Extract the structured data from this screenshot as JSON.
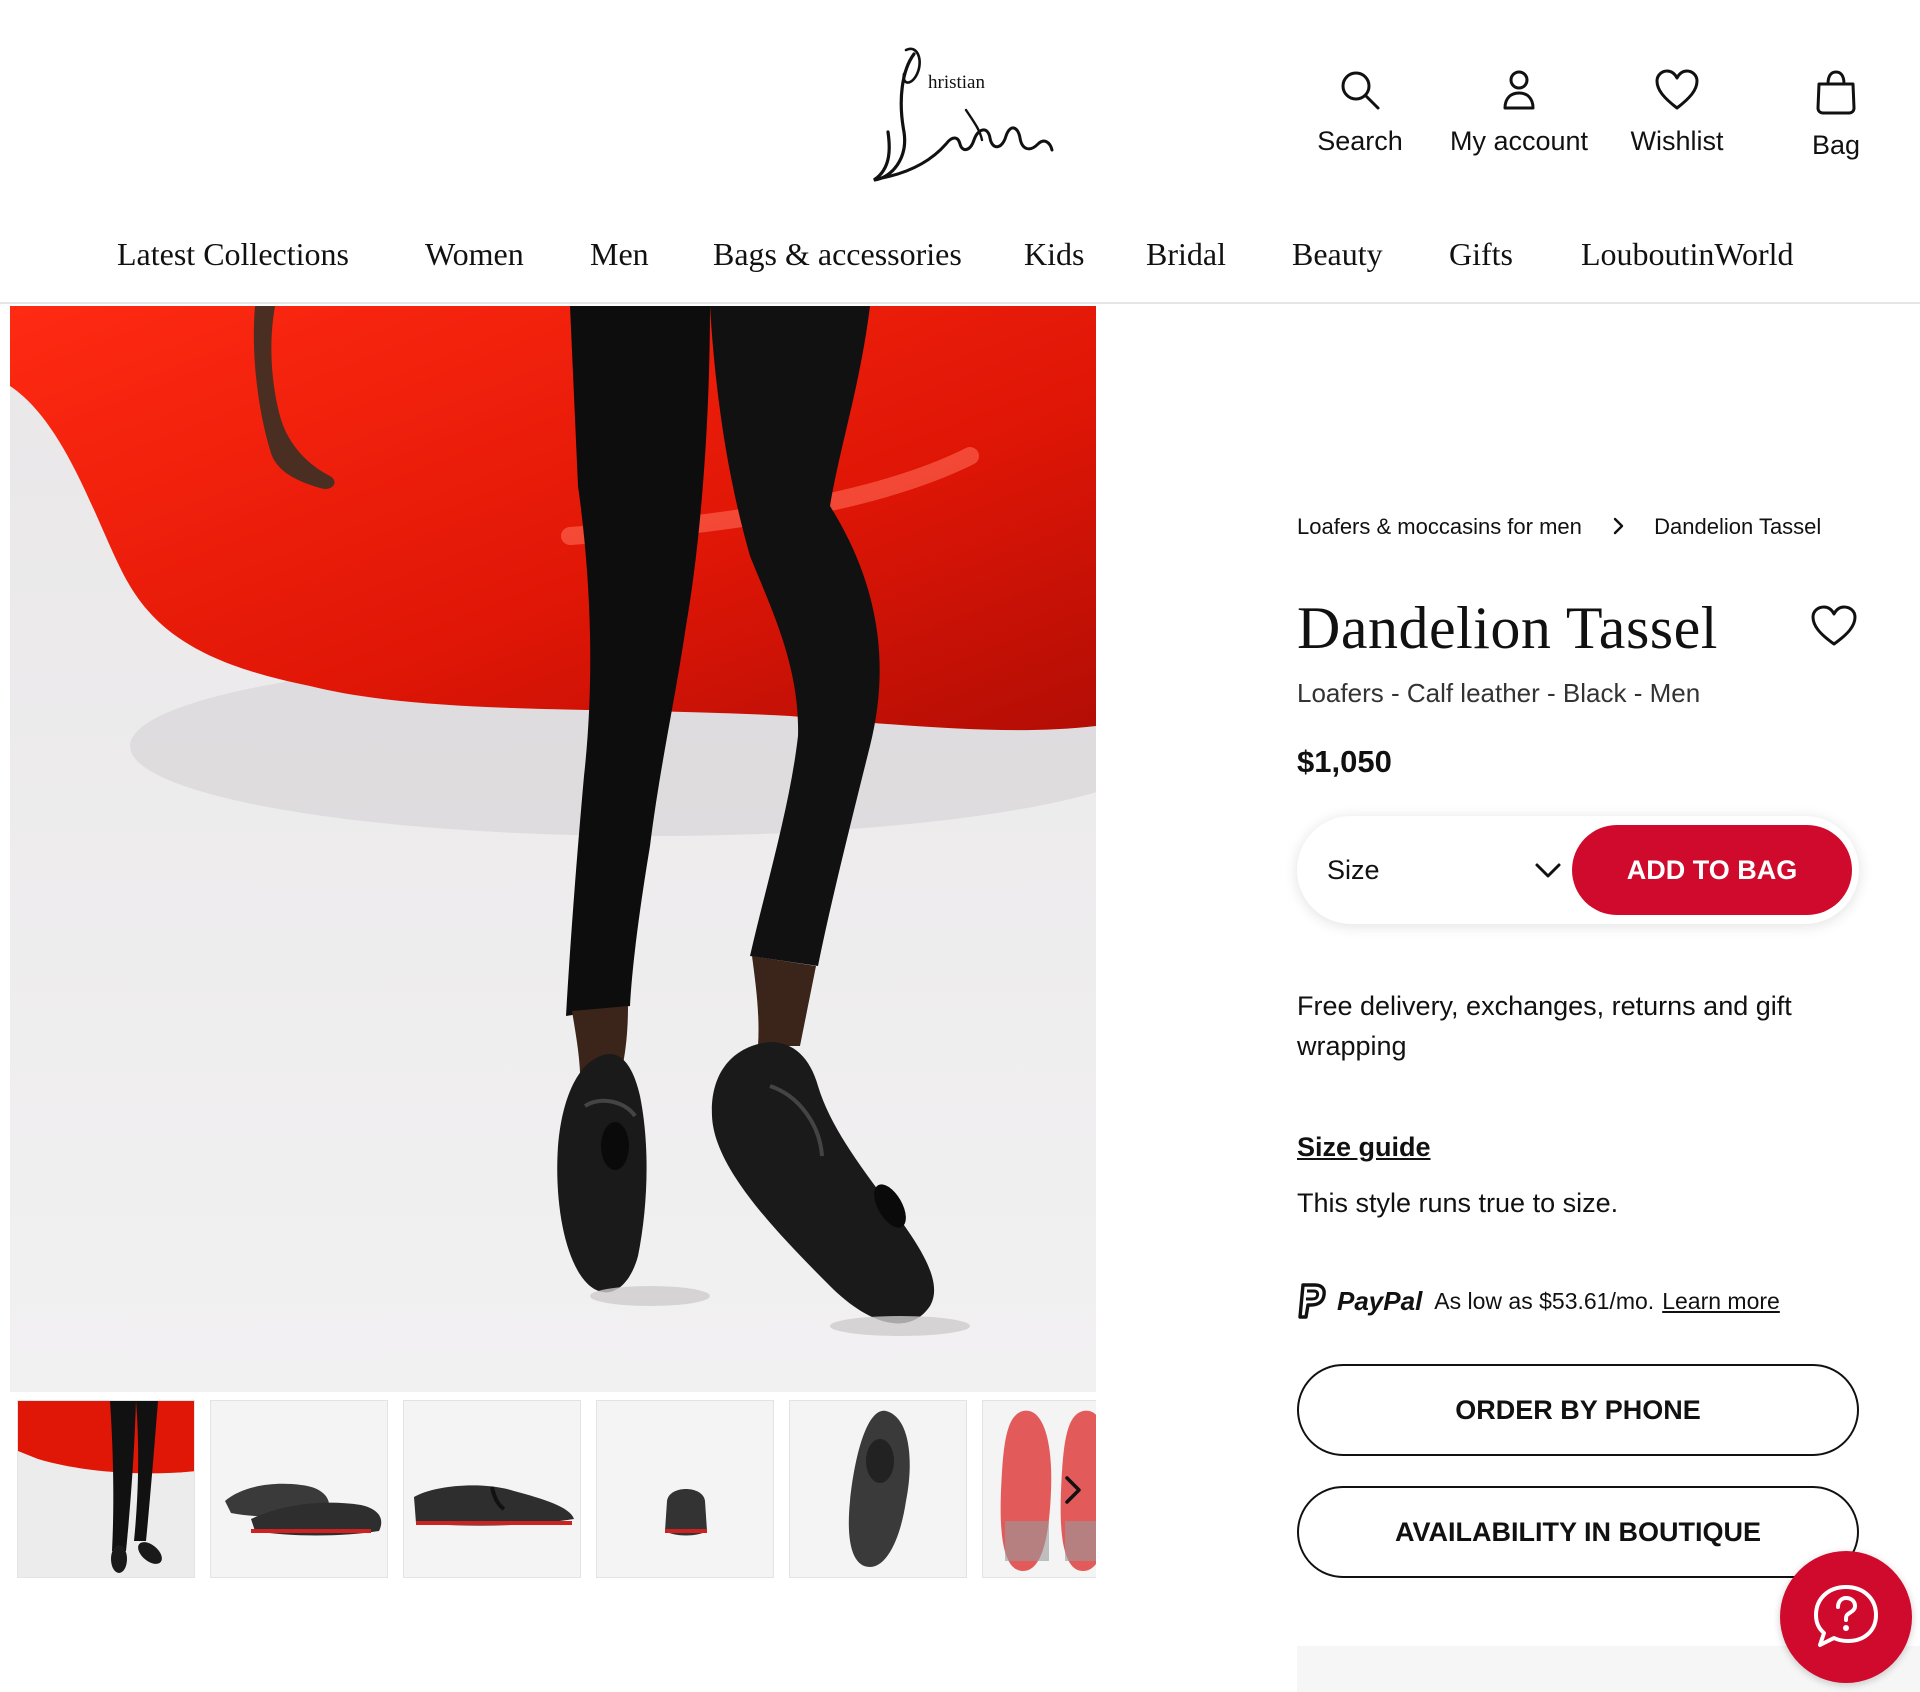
{
  "brand": {
    "logo_alt": "Christian Louboutin",
    "logo_small": "hristian",
    "logo_script": "Louboutin"
  },
  "utility": {
    "search_label": "Search",
    "account_label": "My account",
    "wishlist_label": "Wishlist",
    "bag_label": "Bag"
  },
  "nav": {
    "items": [
      {
        "label": "Latest Collections"
      },
      {
        "label": "Women"
      },
      {
        "label": "Men"
      },
      {
        "label": "Bags & accessories"
      },
      {
        "label": "Kids"
      },
      {
        "label": "Bridal"
      },
      {
        "label": "Beauty"
      },
      {
        "label": "Gifts"
      },
      {
        "label": "LouboutinWorld"
      }
    ]
  },
  "breadcrumb": {
    "parent": "Loafers & moccasins for men",
    "current": "Dandelion Tassel"
  },
  "product": {
    "name": "Dandelion Tassel",
    "subtitle": "Loafers - Calf leather - Black - Men",
    "price": "$1,050",
    "size_label": "Size",
    "add_to_bag": "ADD TO BAG",
    "delivery": "Free delivery, exchanges, returns and gift wrapping",
    "size_guide": "Size guide",
    "fit_note": "This style runs true to size."
  },
  "paypal": {
    "brand": "PayPal",
    "text": "As low as $53.61/mo.",
    "learn_more": "Learn more"
  },
  "actions": {
    "order_by_phone": "ORDER BY PHONE",
    "availability": "AVAILABILITY IN BOUTIQUE"
  },
  "gallery": {
    "thumbnail_count": 6
  },
  "colors": {
    "accent": "#cf0a2c",
    "text": "#111111",
    "border": "#e6e6e6"
  },
  "icons": {
    "search": "search-icon",
    "account": "user-icon",
    "wishlist": "heart-icon",
    "bag": "bag-icon",
    "breadcrumb_separator": "chevron-right-icon",
    "size_dropdown": "chevron-down-icon",
    "gallery_next": "chevron-right-icon",
    "help": "help-chat-icon"
  }
}
